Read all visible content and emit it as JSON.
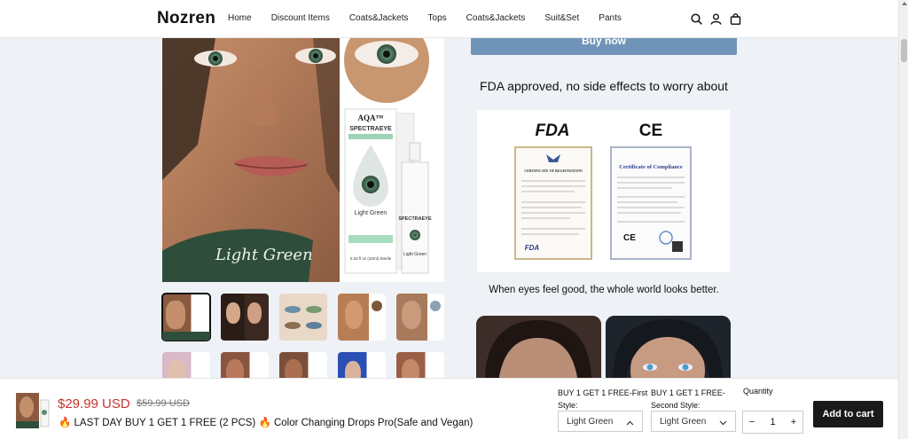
{
  "header": {
    "logo": "Nozren",
    "nav": [
      "Home",
      "Discount Items",
      "Coats&Jackets",
      "Tops",
      "Coats&Jackets",
      "Suit&Set",
      "Pants"
    ],
    "icons": [
      "search-icon",
      "account-icon",
      "cart-icon"
    ]
  },
  "gallery": {
    "main_image_text": {
      "brand": "AQA™",
      "product": "SPECTRAEYE",
      "shade": "Light Green",
      "volume": "0.33 fl oz (10ml) Sterile",
      "caption": "Light Green"
    },
    "thumbnails_count": 10
  },
  "panel": {
    "buy_now": "Buy now",
    "heading1": "FDA approved, no side effects to worry about",
    "cert": {
      "fda_logo": "FDA",
      "ce_logo": "CE",
      "fda_doc_title": "CERTIFICATE OF REGISTRATION",
      "ce_doc_title": "Certificate of Compliance",
      "ce_mark": "CE",
      "fda_mark": "FDA"
    },
    "heading2": "When eyes feel good, the whole world looks better."
  },
  "sticky": {
    "price": "$29.99 USD",
    "compare_price": "$59.99 USD",
    "title": "🔥 LAST DAY BUY 1 GET 1 FREE (2 PCS) 🔥 Color Changing Drops Pro(Safe and Vegan)",
    "option1_label_line1": "BUY 1 GET 1 FREE-First",
    "option1_label_line2": "Style:",
    "option1_value": "Light Green",
    "option2_label_line1": "BUY 1 GET 1 FREE-",
    "option2_label_line2": "Second Style:",
    "option2_value": "Light Green",
    "quantity_label": "Quantity",
    "quantity": "1",
    "minus": "−",
    "plus": "+",
    "add_to_cart": "Add to cart"
  },
  "colors": {
    "accent_button": "#6f94b8",
    "price": "#c4332b",
    "cart_button": "#1a1a1a"
  }
}
